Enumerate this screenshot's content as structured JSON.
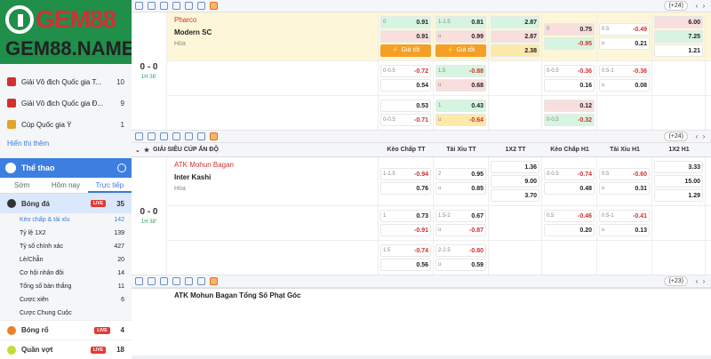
{
  "brand": {
    "logo_text": "GEM88",
    "domain_text": "GEM88.NAME"
  },
  "sidebar": {
    "leagues": [
      {
        "label": "Giải Vô địch Quốc gia T...",
        "count": "10"
      },
      {
        "label": "Giải Vô địch Quốc gia Đ...",
        "count": "9"
      },
      {
        "label": "Cúp Quốc gia Ý",
        "count": "1"
      }
    ],
    "show_more": "Hiển thị thêm",
    "sports_title": "Thể thao",
    "tabs": [
      "Sớm",
      "Hôm nay",
      "Trực tiếp"
    ],
    "soccer": {
      "label": "Bóng đá",
      "badge": "LIVE",
      "count": "35"
    },
    "subs": [
      {
        "label": "Kèo chấp & tài xỉu",
        "count": "142"
      },
      {
        "label": "Tỷ lệ 1X2",
        "count": "139"
      },
      {
        "label": "Tỷ số chính xác",
        "count": "427"
      },
      {
        "label": "Lẻ/Chẵn",
        "count": "20"
      },
      {
        "label": "Cơ hội nhân đôi",
        "count": "14"
      },
      {
        "label": "Tổng số bàn thắng",
        "count": "11"
      },
      {
        "label": "Cược xiên",
        "count": "6"
      },
      {
        "label": "Cược Chung Cuộc",
        "count": ""
      }
    ],
    "basketball": {
      "label": "Bóng rổ",
      "badge": "LIVE",
      "count": "4"
    },
    "icehockey": {
      "label": "Quần vợt",
      "badge": "LIVE",
      "count": "18"
    }
  },
  "match1": {
    "more": "(+24)",
    "team1": "Pharco",
    "team2": "Modern SC",
    "draw": "Hòa",
    "score": "0 - 0",
    "time": "1H 36'",
    "gia_tot": "Giá tốt",
    "rows": [
      [
        [
          [
            "0",
            "0.91"
          ],
          [
            "",
            "0.91"
          ]
        ],
        [
          [
            "1-1.5",
            "0.81"
          ],
          [
            "u",
            "0.99"
          ]
        ],
        [
          [
            "",
            "2.87"
          ],
          [
            "",
            "2.87"
          ],
          [
            "",
            "2.38"
          ]
        ],
        [
          [
            "0",
            "0.75"
          ],
          [
            "",
            "-0.95"
          ]
        ],
        [
          [
            "0.5",
            "-0.49"
          ],
          [
            "u",
            "0.21"
          ]
        ],
        [
          [
            "",
            "6.00"
          ],
          [
            "",
            "7.25"
          ],
          [
            "",
            "1.21"
          ]
        ]
      ],
      [
        [
          [
            "0-0.5",
            "-0.72"
          ],
          [
            "",
            "0.54"
          ]
        ],
        [
          [
            "1.5",
            "-0.88"
          ],
          [
            "u",
            "0.68"
          ]
        ],
        [],
        [
          [
            "0-0.5",
            "-0.36"
          ],
          [
            "",
            "0.16"
          ]
        ],
        [
          [
            "0.5-1",
            "-0.36"
          ],
          [
            "u",
            "0.08"
          ]
        ],
        []
      ],
      [
        [
          [
            "",
            "0.53"
          ],
          [
            "0-0.5",
            "-0.71"
          ]
        ],
        [
          [
            "1",
            "0.43"
          ],
          [
            "u",
            "-0.64"
          ]
        ],
        [],
        [
          [
            "",
            "0.12"
          ],
          [
            "0-0.5",
            "-0.32"
          ]
        ],
        [],
        []
      ]
    ]
  },
  "league2": {
    "name": "GIẢI SIÊU CÚP ẤN ĐỘ",
    "headers": [
      "Kèo Chấp TT",
      "Tài Xỉu TT",
      "1X2 TT",
      "Kèo Chấp H1",
      "Tài Xỉu H1",
      "1X2 H1"
    ]
  },
  "match2": {
    "more": "(+23)",
    "team1": "ATK Mohun Bagan",
    "team2": "Inter Kashi",
    "draw": "Hòa",
    "score": "0 - 0",
    "time": "1H 38'",
    "rows": [
      [
        [
          [
            "1-1.5",
            "-0.94"
          ],
          [
            "",
            "0.76"
          ]
        ],
        [
          [
            "2",
            "0.95"
          ],
          [
            "u",
            "0.85"
          ]
        ],
        [
          [
            "",
            "1.36"
          ],
          [
            "",
            "9.00"
          ],
          [
            "",
            "3.70"
          ]
        ],
        [
          [
            "0-0.5",
            "-0.74"
          ],
          [
            "",
            "0.48"
          ]
        ],
        [
          [
            "0.5",
            "-0.60"
          ],
          [
            "u",
            "0.31"
          ]
        ],
        [
          [
            "",
            "3.33"
          ],
          [
            "",
            "15.00"
          ],
          [
            "",
            "1.29"
          ]
        ]
      ],
      [
        [
          [
            "1",
            "0.73"
          ],
          [
            "",
            "-0.91"
          ]
        ],
        [
          [
            "1.5-2",
            "0.67"
          ],
          [
            "u",
            "-0.87"
          ]
        ],
        [],
        [
          [
            "0.5",
            "-0.46"
          ],
          [
            "",
            "0.20"
          ]
        ],
        [
          [
            "0.5-1",
            "-0.41"
          ],
          [
            "u",
            "0.13"
          ]
        ],
        []
      ],
      [
        [
          [
            "1.5",
            "-0.74"
          ],
          [
            "",
            "0.56"
          ]
        ],
        [
          [
            "2-2.5",
            "-0.80"
          ],
          [
            "u",
            "0.59"
          ]
        ],
        [],
        [],
        [],
        []
      ]
    ]
  },
  "next_match": "ATK Mohun Bagan Tổng Số Phạt Góc"
}
